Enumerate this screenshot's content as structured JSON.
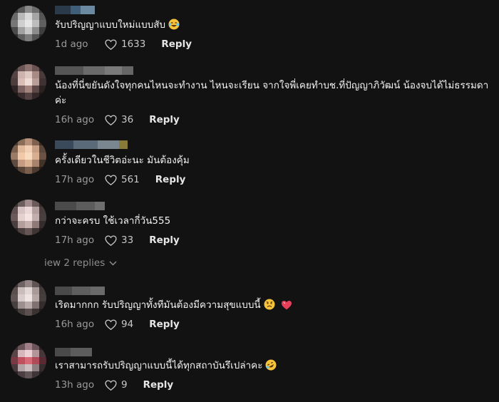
{
  "comments": [
    {
      "text": "รับปริญญาแบบใหม่แบบสับ",
      "emoji": "laughing-tears-emoji",
      "time": "1d ago",
      "likes": "1633",
      "reply_label": "Reply"
    },
    {
      "text": "น้องที่นี่ขยันดังใจทุกคนไหนจะทำงาน ไหนจะเรียน จากใจพี่เคยทำบช.ที่ปัญญาภิวัฒน์ น้องจบได้ไม่ธรรมดาค่ะ",
      "time": "16h ago",
      "likes": "36",
      "reply_label": "Reply"
    },
    {
      "text": "ครั้งเดียวในชีวิตอ่ะนะ มันต้องคุ้ม",
      "time": "17h ago",
      "likes": "561",
      "reply_label": "Reply"
    },
    {
      "text": "กว่าจะครบ ใช้เวลากี่วัน555",
      "time": "17h ago",
      "likes": "33",
      "reply_label": "Reply"
    },
    {
      "text": "เริดมากกก รับปริญญาทั้งทีมันต้องมีความสุขแบบนี้",
      "emoji": "worried-face-emoji heart-emoji",
      "time": "16h ago",
      "likes": "94",
      "reply_label": "Reply"
    },
    {
      "text": "เราสามารถรับปริญญาแบบนี้ได้ทุกสถาบันรึเปล่าคะ",
      "emoji": "rofl-emoji",
      "time": "13h ago",
      "likes": "9",
      "reply_label": "Reply"
    }
  ],
  "view_replies_label": "iew 2 replies",
  "colors": {
    "background": "#121212",
    "text": "#f2f2f2",
    "muted": "#9a9a9a"
  }
}
